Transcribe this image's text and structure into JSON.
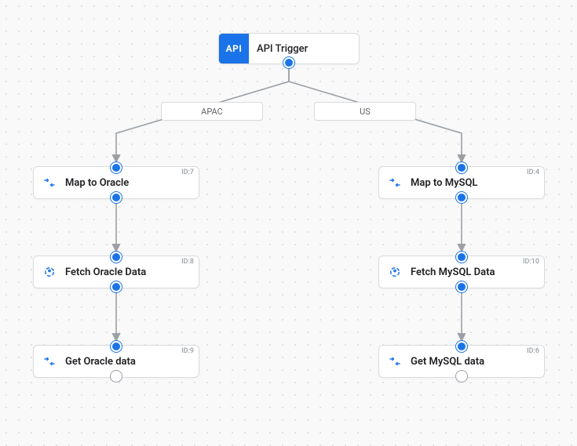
{
  "trigger": {
    "badge": "API",
    "label": "API Trigger"
  },
  "branches": {
    "left": {
      "label": "APAC"
    },
    "right": {
      "label": "US"
    }
  },
  "nodes": {
    "n7": {
      "label": "Map to Oracle",
      "id": "ID:7"
    },
    "n8": {
      "label": "Fetch Oracle Data",
      "id": "ID:8"
    },
    "n9": {
      "label": "Get Oracle data",
      "id": "ID:9"
    },
    "n4": {
      "label": "Map to MySQL",
      "id": "ID:4"
    },
    "n10": {
      "label": "Fetch MySQL Data",
      "id": "ID:10"
    },
    "n6": {
      "label": "Get MySQL data",
      "id": "ID:6"
    }
  },
  "colors": {
    "accent": "#1a73e8",
    "edge": "#9aa0a6"
  }
}
